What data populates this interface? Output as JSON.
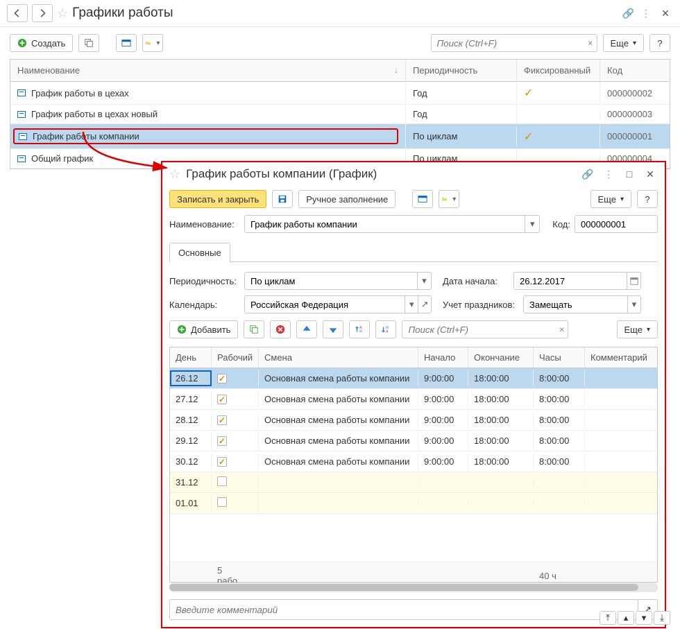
{
  "header": {
    "title": "Графики работы",
    "create": "Создать",
    "search_placeholder": "Поиск (Ctrl+F)",
    "more": "Еще"
  },
  "columns": {
    "name": "Наименование",
    "period": "Периодичность",
    "fixed": "Фиксированный",
    "code": "Код"
  },
  "rows": [
    {
      "name": "График работы в цехах",
      "period": "Год",
      "fixed": true,
      "code": "000000002"
    },
    {
      "name": "График работы в цехах новый",
      "period": "Год",
      "fixed": false,
      "code": "000000003"
    },
    {
      "name": "График работы компании",
      "period": "По циклам",
      "fixed": true,
      "code": "000000001",
      "selected": true
    },
    {
      "name": "Общий график",
      "period": "По циклам",
      "fixed": false,
      "code": "000000004"
    }
  ],
  "dialog": {
    "title": "График работы компании (График)",
    "save_close": "Записать и закрыть",
    "manual": "Ручное заполнение",
    "more": "Еще",
    "name_label": "Наименование:",
    "name_value": "График работы компании",
    "code_label": "Код:",
    "code_value": "000000001",
    "tab_main": "Основные",
    "period_label": "Периодичность:",
    "period_value": "По циклам",
    "start_label": "Дата начала:",
    "start_value": "26.12.2017",
    "calendar_label": "Календарь:",
    "calendar_value": "Российская Федерация",
    "holidays_label": "Учет праздников:",
    "holidays_value": "Замещать",
    "add": "Добавить",
    "search_placeholder": "Поиск (Ctrl+F)",
    "cols": {
      "day": "День",
      "working": "Рабочий",
      "shift": "Смена",
      "start": "Начало",
      "end": "Окончание",
      "hours": "Часы",
      "comment": "Комментарий"
    },
    "days": [
      {
        "day": "26.12",
        "working": true,
        "shift": "Основная смена работы компании",
        "start": "9:00:00",
        "end": "18:00:00",
        "hours": "8:00:00",
        "sel": true
      },
      {
        "day": "27.12",
        "working": true,
        "shift": "Основная смена работы компании",
        "start": "9:00:00",
        "end": "18:00:00",
        "hours": "8:00:00"
      },
      {
        "day": "28.12",
        "working": true,
        "shift": "Основная смена работы компании",
        "start": "9:00:00",
        "end": "18:00:00",
        "hours": "8:00:00"
      },
      {
        "day": "29.12",
        "working": true,
        "shift": "Основная смена работы компании",
        "start": "9:00:00",
        "end": "18:00:00",
        "hours": "8:00:00"
      },
      {
        "day": "30.12",
        "working": true,
        "shift": "Основная смена работы компании",
        "start": "9:00:00",
        "end": "18:00:00",
        "hours": "8:00:00"
      },
      {
        "day": "31.12",
        "working": false,
        "weekend": true
      },
      {
        "day": "01.01",
        "working": false,
        "weekend": true
      }
    ],
    "summary_working": "5 рабо…",
    "summary_hours": "40 ч",
    "comment_placeholder": "Введите комментарий"
  }
}
